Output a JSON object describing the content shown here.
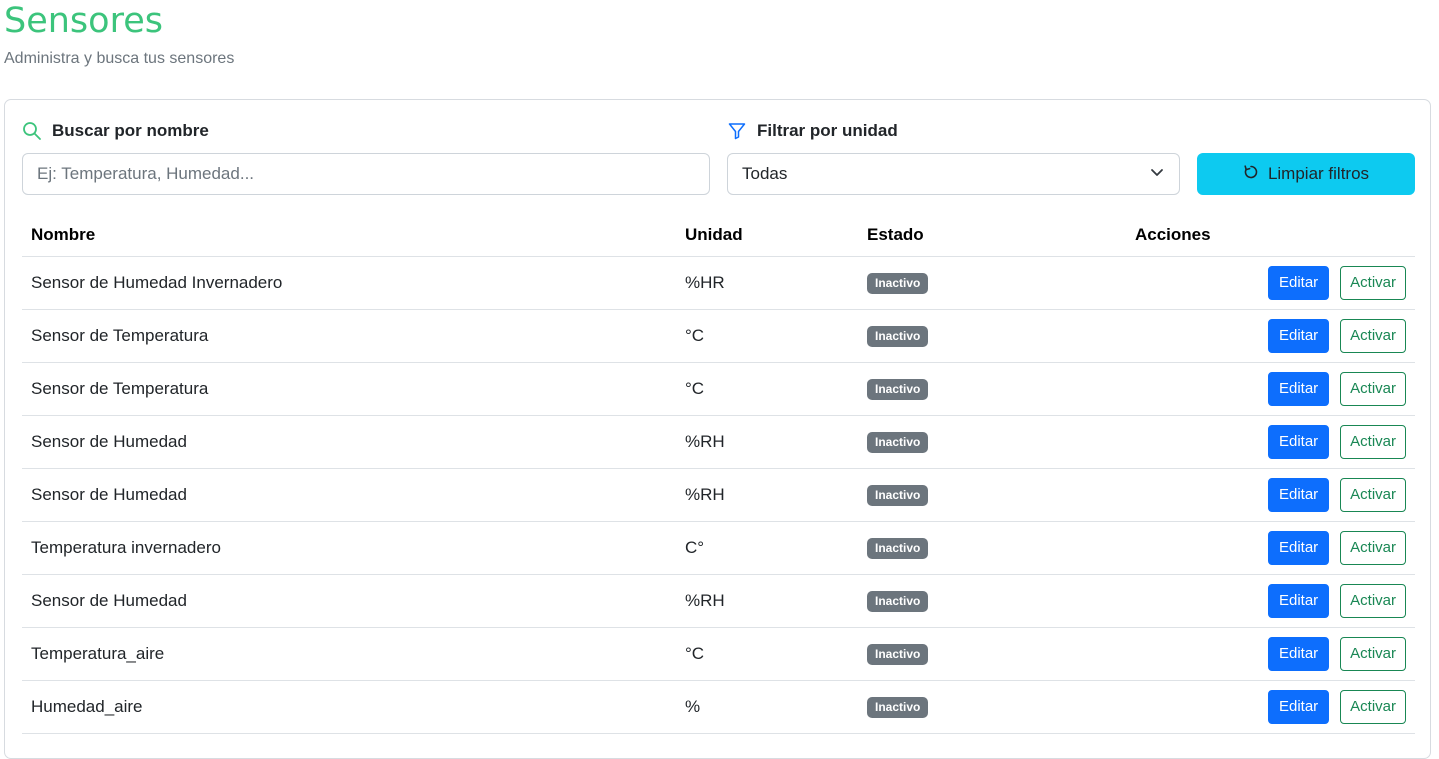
{
  "header": {
    "title": "Sensores",
    "subtitle": "Administra y busca tus sensores"
  },
  "filters": {
    "search_label": "Buscar por nombre",
    "search_placeholder": "Ej: Temperatura, Humedad...",
    "search_value": "",
    "unit_label": "Filtrar por unidad",
    "unit_selected": "Todas",
    "clear_label": "Limpiar filtros"
  },
  "table": {
    "headers": {
      "name": "Nombre",
      "unit": "Unidad",
      "status": "Estado",
      "actions": "Acciones"
    },
    "rows": [
      {
        "name": "Sensor de Humedad Invernadero",
        "unit": "%HR",
        "status": "Inactivo",
        "edit": "Editar",
        "action": "Activar"
      },
      {
        "name": "Sensor de Temperatura",
        "unit": "°C",
        "status": "Inactivo",
        "edit": "Editar",
        "action": "Activar"
      },
      {
        "name": "Sensor de Temperatura",
        "unit": "°C",
        "status": "Inactivo",
        "edit": "Editar",
        "action": "Activar"
      },
      {
        "name": "Sensor de Humedad",
        "unit": "%RH",
        "status": "Inactivo",
        "edit": "Editar",
        "action": "Activar"
      },
      {
        "name": "Sensor de Humedad",
        "unit": "%RH",
        "status": "Inactivo",
        "edit": "Editar",
        "action": "Activar"
      },
      {
        "name": "Temperatura invernadero",
        "unit": "C°",
        "status": "Inactivo",
        "edit": "Editar",
        "action": "Activar"
      },
      {
        "name": "Sensor de Humedad",
        "unit": "%RH",
        "status": "Inactivo",
        "edit": "Editar",
        "action": "Activar"
      },
      {
        "name": "Temperatura_aire",
        "unit": "°C",
        "status": "Inactivo",
        "edit": "Editar",
        "action": "Activar"
      },
      {
        "name": "Humedad_aire",
        "unit": "%",
        "status": "Inactivo",
        "edit": "Editar",
        "action": "Activar"
      }
    ]
  },
  "colors": {
    "title_green": "#3cc47c",
    "primary_blue": "#0d6efd",
    "info_cyan": "#0dcaf0",
    "success_green": "#198754",
    "badge_gray": "#6c757d"
  },
  "icons": {
    "search": "search-icon",
    "filter": "filter-icon",
    "chevron": "chevron-down-icon",
    "reset": "refresh-icon"
  }
}
